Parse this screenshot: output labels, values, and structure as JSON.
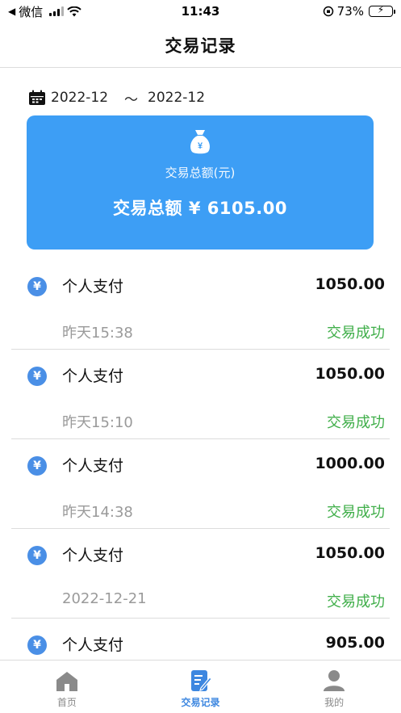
{
  "status_bar": {
    "back_app": "微信",
    "time": "11:43",
    "battery": "73%",
    "battery_level": 0.73
  },
  "nav": {
    "title": "交易记录"
  },
  "date_range": {
    "start": "2022-12",
    "separator": "～",
    "end": "2022-12"
  },
  "summary": {
    "label": "交易总额(元)",
    "total": "交易总额 ¥ 6105.00",
    "bag_symbol": "¥",
    "card_color": "#3d9ef5"
  },
  "transactions": [
    {
      "icon": "¥",
      "type": "个人支付",
      "amount": "1050.00",
      "time": "昨天15:38",
      "status": "交易成功"
    },
    {
      "icon": "¥",
      "type": "个人支付",
      "amount": "1050.00",
      "time": "昨天15:10",
      "status": "交易成功"
    },
    {
      "icon": "¥",
      "type": "个人支付",
      "amount": "1000.00",
      "time": "昨天14:38",
      "status": "交易成功"
    },
    {
      "icon": "¥",
      "type": "个人支付",
      "amount": "1050.00",
      "time": "2022-12-21",
      "status": "交易成功"
    },
    {
      "icon": "¥",
      "type": "个人支付",
      "amount": "905.00",
      "time": "",
      "status": ""
    }
  ],
  "tabs": [
    {
      "label": "首页",
      "icon": "home-icon"
    },
    {
      "label": "交易记录",
      "icon": "records-icon"
    },
    {
      "label": "我的",
      "icon": "profile-icon"
    }
  ],
  "colors": {
    "accent": "#3d87e0",
    "success": "#3fae49",
    "muted": "#9a9a9a"
  }
}
